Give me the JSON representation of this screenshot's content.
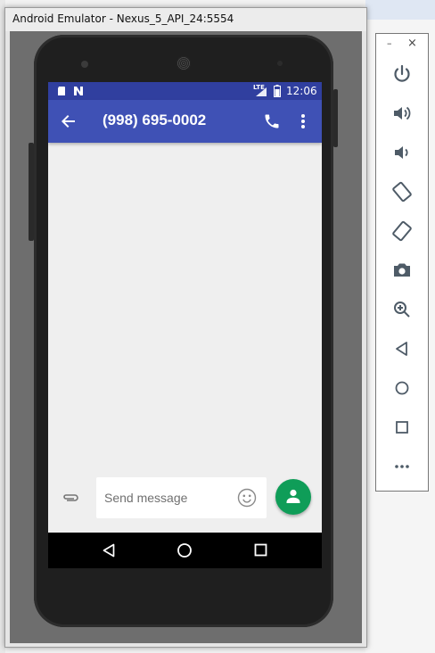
{
  "window": {
    "title": "Android Emulator - Nexus_5_API_24:5554"
  },
  "status_bar": {
    "time": "12:06",
    "network": "LTE"
  },
  "app_bar": {
    "title": "(998) 695-0002"
  },
  "compose": {
    "placeholder": "Send message"
  },
  "colors": {
    "status_bar": "#303f9f",
    "app_bar": "#3f51b5",
    "fab": "#0f9d58",
    "screen_bg": "#efefef"
  },
  "toolbar": {
    "minimize": "–",
    "close": "×",
    "buttons": [
      "power-icon",
      "volume-up-icon",
      "volume-down-icon",
      "rotate-left-icon",
      "rotate-right-icon",
      "camera-icon",
      "zoom-icon",
      "back-icon",
      "home-icon",
      "overview-icon",
      "more-icon"
    ]
  }
}
